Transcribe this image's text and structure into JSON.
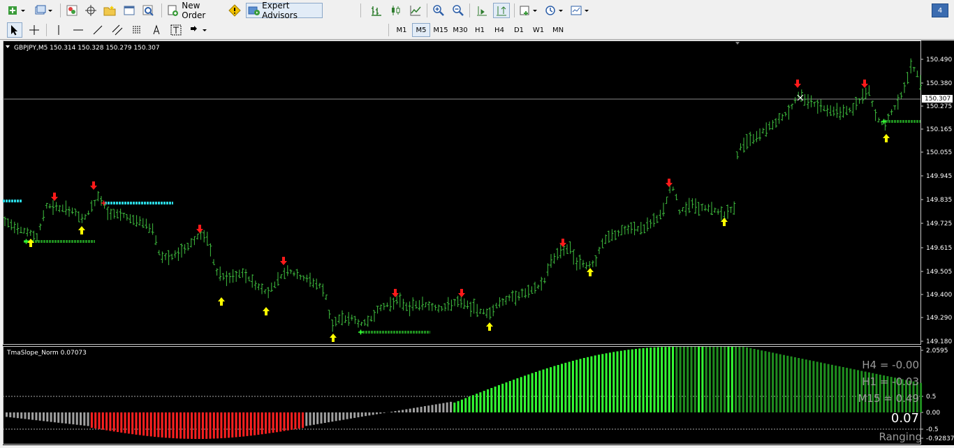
{
  "toolbar": {
    "new_order_label": "New Order",
    "expert_advisors_label": "Expert Advisors",
    "window_number": "4"
  },
  "timeframes": [
    "M1",
    "M5",
    "M15",
    "M30",
    "H1",
    "H4",
    "D1",
    "W1",
    "MN"
  ],
  "active_timeframe": "M5",
  "chart": {
    "header": "GBPJPY,M5  150.314 150.328 150.279 150.307",
    "price_ticks": [
      "150.490",
      "150.380",
      "150.275",
      "150.165",
      "150.055",
      "149.945",
      "149.835",
      "149.725",
      "149.615",
      "149.505",
      "149.400",
      "149.290",
      "149.180"
    ],
    "current_price": "150.307",
    "colors": {
      "background": "#000000",
      "bars": "#3fbf3f",
      "up_arrow": "#ffff00",
      "down_arrow": "#ff1a1a",
      "support": "#1f8f1f",
      "resistance": "#29d6e0"
    }
  },
  "indicator": {
    "header": "TmaSlope_Norm 0.07073",
    "scale_ticks": [
      "2.0595",
      "0.5",
      "0.00",
      "-0.5",
      "-0.92837"
    ],
    "h4_text": "H4 = -0.00",
    "h1_text": "H1 = -0.03",
    "m15_text": "M15 = 0.49",
    "value_text": "0.07",
    "status_text": "Ranging",
    "colors": {
      "red": "#ff2020",
      "gray": "#a0a0a0",
      "bright_green": "#33ff33",
      "dark_green": "#1f8f1f"
    }
  }
}
